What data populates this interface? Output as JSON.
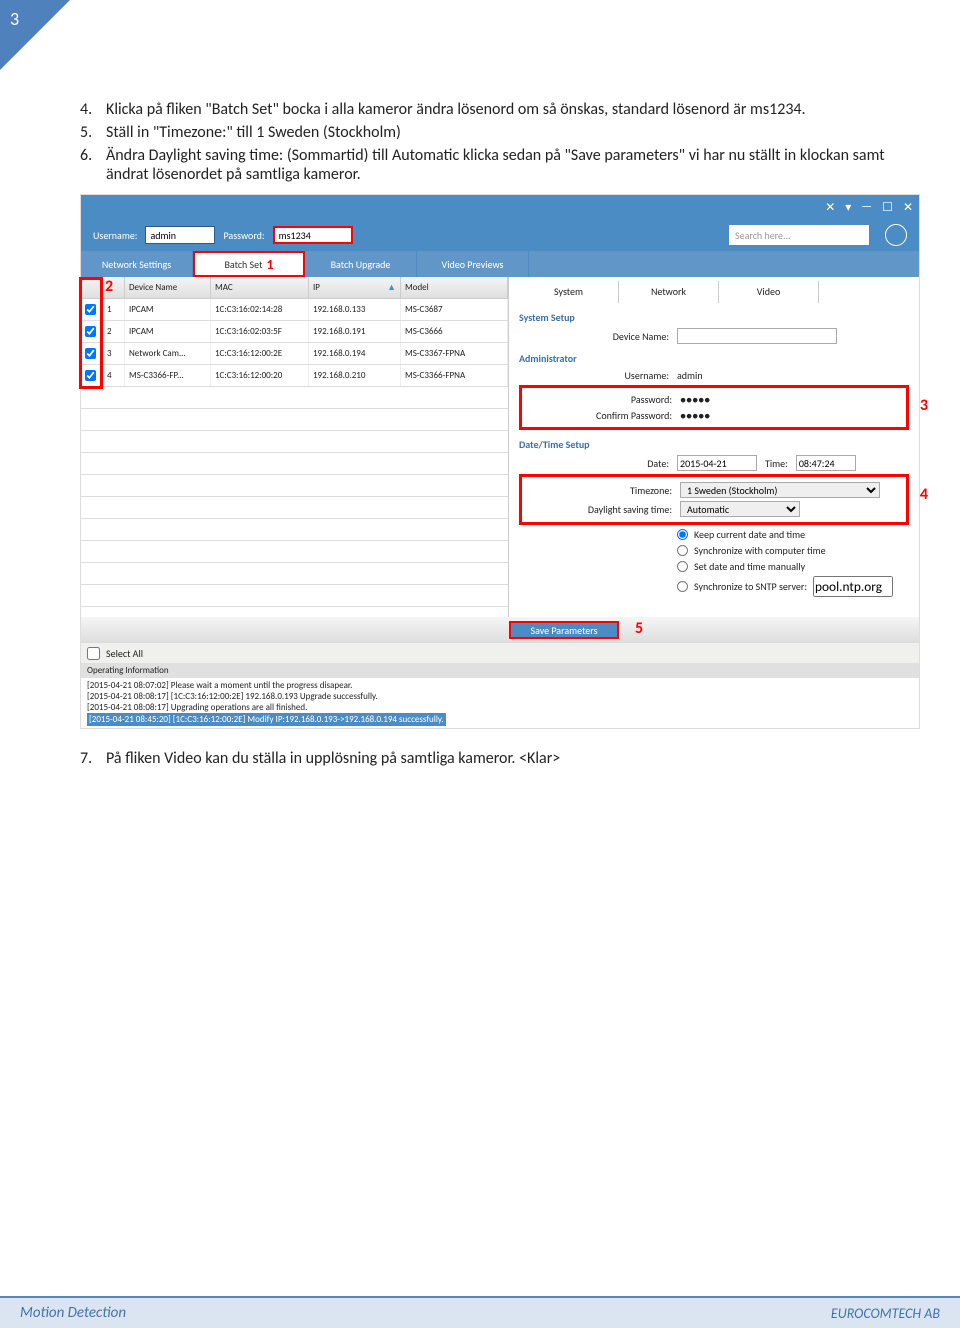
{
  "page_number": "3",
  "instructions": [
    {
      "num": "4.",
      "text": "Klicka på fliken \"Batch Set\" bocka i alla kameror ändra lösenord om så önskas, standard lösenord är ms1234."
    },
    {
      "num": "5.",
      "text": "Ställ in \"Timezone:\" till 1 Sweden (Stockholm)"
    },
    {
      "num": "6.",
      "text": "Ändra Daylight saving time: (Sommartid) till Automatic klicka sedan på \"Save parameters\" vi har nu ställt in klockan samt ändrat lösenordet på samtliga kameror."
    }
  ],
  "after_text": {
    "num": "7.",
    "text": "På fliken Video kan du ställa in upplösning på samtliga kameror. <Klar>"
  },
  "app": {
    "cred": {
      "username_label": "Username:",
      "username": "admin",
      "password_label": "Password:",
      "password": "ms1234"
    },
    "search_placeholder": "Search here...",
    "tabs": [
      "Network Settings",
      "Batch Set",
      "Batch Upgrade",
      "Video Previews"
    ],
    "markers": {
      "m1": "1",
      "m2": "2",
      "m3": "3",
      "m4": "4",
      "m5": "5"
    },
    "table": {
      "headers": {
        "device": "Device Name",
        "mac": "MAC",
        "ip": "IP",
        "model": "Model"
      },
      "rows": [
        {
          "n": "1",
          "device": "IPCAM",
          "mac": "1C:C3:16:02:14:28",
          "ip": "192.168.0.133",
          "model": "MS-C3687"
        },
        {
          "n": "2",
          "device": "IPCAM",
          "mac": "1C:C3:16:02:03:5F",
          "ip": "192.168.0.191",
          "model": "MS-C3666"
        },
        {
          "n": "3",
          "device": "Network Cam...",
          "mac": "1C:C3:16:12:00:2E",
          "ip": "192.168.0.194",
          "model": "MS-C3367-FPNA"
        },
        {
          "n": "4",
          "device": "MS-C3366-FP...",
          "mac": "1C:C3:16:12:00:20",
          "ip": "192.168.0.210",
          "model": "MS-C3366-FPNA"
        }
      ]
    },
    "right": {
      "tabs": [
        "System",
        "Network",
        "Video"
      ],
      "system_setup": "System Setup",
      "device_name": "Device Name:",
      "administrator": "Administrator",
      "username_label": "Username:",
      "username": "admin",
      "password_label": "Password:",
      "password": "●●●●●",
      "confirm_label": "Confirm Password:",
      "confirm": "●●●●●",
      "datetime": "Date/Time Setup",
      "date_label": "Date:",
      "date": "2015-04-21",
      "time_label": "Time:",
      "time": "08:47:24",
      "tz_label": "Timezone:",
      "tz": "1 Sweden (Stockholm)",
      "dst_label": "Daylight saving time:",
      "dst": "Automatic",
      "radio1": "Keep current date and time",
      "radio2": "Synchronize with computer time",
      "radio3": "Set date and time manually",
      "radio4": "Synchronize to SNTP server:",
      "sntp": "pool.ntp.org"
    },
    "save_label": "Save Parameters",
    "select_all": "Select All",
    "op_info": "Operating Information",
    "logs": [
      "[2015-04-21 08:07:02] Please wait a moment until the progress disapear.",
      "[2015-04-21 08:08:17] [1C:C3:16:12:00:2E] 192.168.0.193 Upgrade successfully.",
      "[2015-04-21 08:08:17] Upgrading operations are all finished."
    ],
    "log_hl": "[2015-04-21 08:45:20] [1C:C3:16:12:00:2E] Modify IP:192.168.0.193->192.168.0.194 successfully."
  },
  "footer": {
    "left": "Motion Detection",
    "right": "EUROCOMTECH AB"
  }
}
